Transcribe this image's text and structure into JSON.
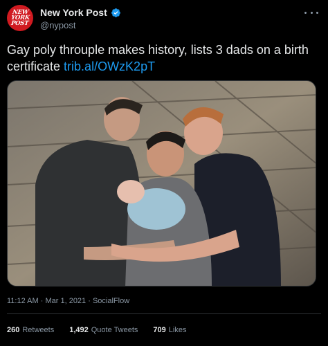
{
  "header": {
    "avatar_lines": [
      "NEW",
      "YORK",
      "POST"
    ],
    "display_name": "New York Post",
    "handle": "@nypost"
  },
  "tweet": {
    "text": "Gay poly throuple makes history, lists 3 dads on a birth certificate",
    "link": "trib.al/OWzK2pT"
  },
  "meta": {
    "time": "11:12 AM",
    "date": "Mar 1, 2021",
    "source": "SocialFlow",
    "separator": "·"
  },
  "stats": [
    {
      "count": "260",
      "label": "Retweets"
    },
    {
      "count": "1,492",
      "label": "Quote Tweets"
    },
    {
      "count": "709",
      "label": "Likes"
    }
  ],
  "colors": {
    "background": "#000000",
    "text": "#e7e9ea",
    "secondary": "#8b98a5",
    "link": "#1d9bf0",
    "verified": "#1d9bf0",
    "avatar": "#d01a20",
    "border": "#2f3336"
  },
  "icons": {
    "verified": "verified-badge-icon",
    "more": "more-horizontal-icon"
  }
}
